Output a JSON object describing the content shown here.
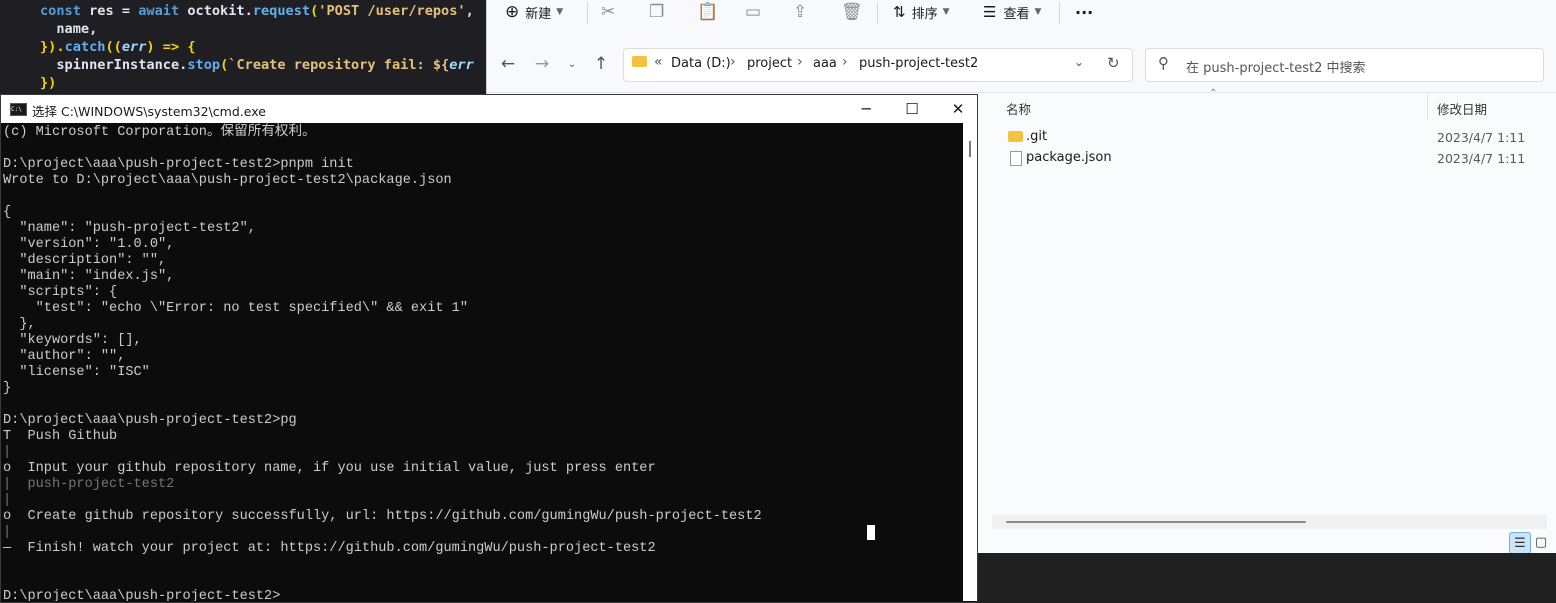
{
  "editor": {
    "line1": {
      "kw": "const",
      "pl1": " res = ",
      "kw2": "await",
      "pl2": " octokit.",
      "fn": "request",
      "pl3": "(",
      "str": "'POST /user/repos'",
      "pl4": ","
    },
    "line2": "  name,",
    "line3": {
      "pl1": "}).",
      "fn": "catch",
      "pl2": "((",
      "it": "err",
      "pl3": ") => {"
    },
    "line4": {
      "pl1": "  spinnerInstance.",
      "fn": "stop",
      "pl2": "(",
      "str": "`Create repository fail: ${",
      "it": "err"
    },
    "line5": "})"
  },
  "explorer": {
    "toolbar": {
      "new_label": "新建",
      "sort_label": "排序",
      "view_label": "查看",
      "more_label": "···"
    },
    "address": {
      "crumbs": [
        "Data (D:)",
        "project",
        "aaa",
        "push-project-test2"
      ],
      "overflow": "«"
    },
    "search_placeholder": "在 push-project-test2 中搜索",
    "columns": {
      "name": "名称",
      "date": "修改日期"
    },
    "files": [
      {
        "name": ".git",
        "date": "2023/4/7 1:11",
        "icon": "folder-icon"
      },
      {
        "name": "package.json",
        "date": "2023/4/7 1:11",
        "icon": "file-icon"
      }
    ]
  },
  "cmd": {
    "title": "选择 C:\\WINDOWS\\system32\\cmd.exe",
    "lines": [
      "(c) Microsoft Corporation。保留所有权利。",
      "",
      "D:\\project\\aaa\\push-project-test2>pnpm init",
      "Wrote to D:\\project\\aaa\\push-project-test2\\package.json",
      "",
      "{",
      "  \"name\": \"push-project-test2\",",
      "  \"version\": \"1.0.0\",",
      "  \"description\": \"\",",
      "  \"main\": \"index.js\",",
      "  \"scripts\": {",
      "    \"test\": \"echo \\\"Error: no test specified\\\" && exit 1\"",
      "  },",
      "  \"keywords\": [],",
      "  \"author\": \"\",",
      "  \"license\": \"ISC\"",
      "}",
      "",
      "D:\\project\\aaa\\push-project-test2>pg",
      "T  Push Github",
      "|",
      "o  Input your github repository name, if you use initial value, just press enter",
      "|  push-project-test2",
      "|",
      "o  Create github repository successfully, url: https://github.com/gumingWu/push-project-test2",
      "|",
      "—  Finish! watch your project at: https://github.com/gumingWu/push-project-test2",
      "",
      "",
      "D:\\project\\aaa\\push-project-test2>"
    ]
  }
}
